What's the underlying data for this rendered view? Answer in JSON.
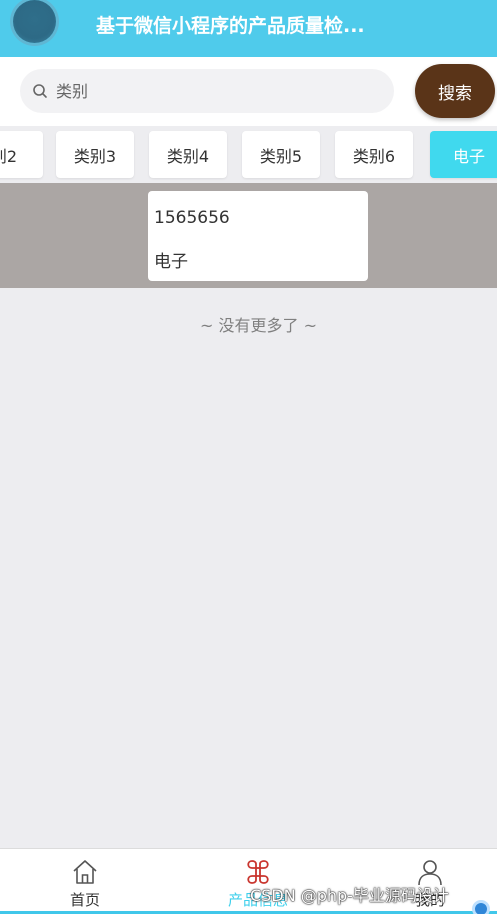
{
  "header": {
    "title": "基于微信小程序的产品质量检..."
  },
  "search": {
    "placeholder": "类别",
    "button_label": "搜索"
  },
  "tabs": [
    {
      "label": "别2",
      "active": false
    },
    {
      "label": "类别3",
      "active": false
    },
    {
      "label": "类别4",
      "active": false
    },
    {
      "label": "类别5",
      "active": false
    },
    {
      "label": "类别6",
      "active": false
    },
    {
      "label": "电子",
      "active": true
    }
  ],
  "products": [
    {
      "id": "1565656",
      "category": "电子"
    }
  ],
  "list_footer": "~ 没有更多了 ~",
  "bottom_nav": [
    {
      "label": "首页",
      "icon": "home-icon",
      "active": false
    },
    {
      "label": "产品信息",
      "icon": "product-icon",
      "active": true
    },
    {
      "label": "我的",
      "icon": "user-icon",
      "active": false
    }
  ],
  "watermark": "CSDN @php-毕业源码设计",
  "colors": {
    "header_bg": "#4fcbeb",
    "search_button_bg": "#5a3418",
    "active_tab_bg": "#40d9ee",
    "active_nav_text": "#40d0ec"
  }
}
